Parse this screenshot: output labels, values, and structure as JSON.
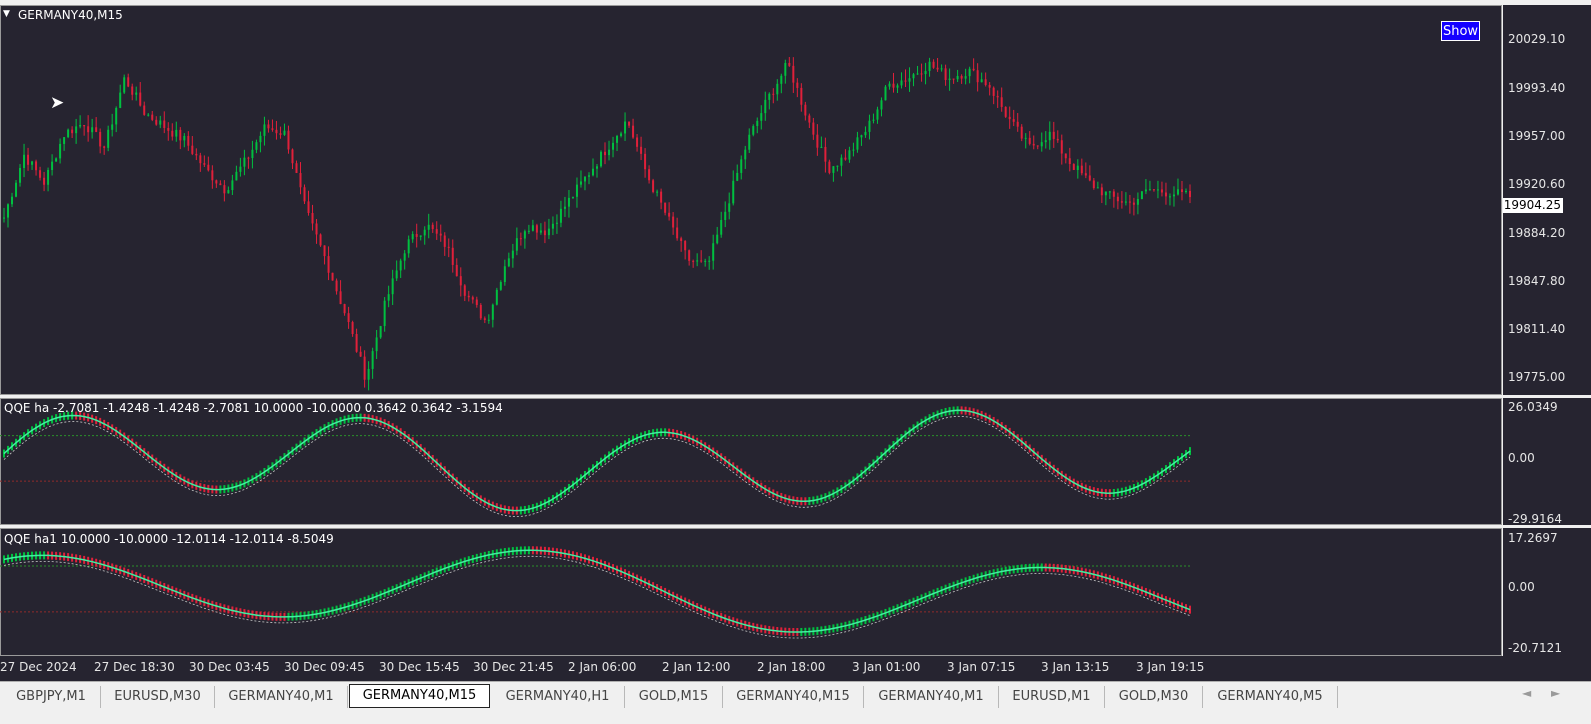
{
  "main_chart": {
    "title": "GERMANY40,M15",
    "show_button": "Show",
    "current_price": "19904.25",
    "y_ticks": [
      "20029.10",
      "19993.40",
      "19957.00",
      "19920.60",
      "19884.20",
      "19847.80",
      "19811.40",
      "19775.00"
    ],
    "colors": {
      "bull": "#00c040",
      "bear": "#e0203a",
      "background": "#262430"
    }
  },
  "indicator1": {
    "label": "QQE ha -2.7081 -1.4248 -1.4248 -2.7081 10.0000 -10.0000 0.3642 0.3642 -3.1594",
    "y_ticks": [
      "26.0349",
      "0.00",
      "-29.9164"
    ]
  },
  "indicator2": {
    "label": "QQE ha1 10.0000 -10.0000 -12.0114 -12.0114 -8.5049",
    "y_ticks": [
      "17.2697",
      "0.00",
      "-20.7121"
    ]
  },
  "x_axis": {
    "ticks": [
      "27 Dec 2024",
      "27 Dec 18:30",
      "30 Dec 03:45",
      "30 Dec 09:45",
      "30 Dec 15:45",
      "30 Dec 21:45",
      "2 Jan 06:00",
      "2 Jan 12:00",
      "2 Jan 18:00",
      "3 Jan 01:00",
      "3 Jan 07:15",
      "3 Jan 13:15",
      "3 Jan 19:15"
    ]
  },
  "tabs": [
    {
      "label": "GBPJPY,M1",
      "active": false
    },
    {
      "label": "EURUSD,M30",
      "active": false
    },
    {
      "label": "GERMANY40,M1",
      "active": false
    },
    {
      "label": "GERMANY40,M15",
      "active": true
    },
    {
      "label": "GERMANY40,H1",
      "active": false
    },
    {
      "label": "GOLD,M15",
      "active": false
    },
    {
      "label": "GERMANY40,M15",
      "active": false
    },
    {
      "label": "GERMANY40,M1",
      "active": false
    },
    {
      "label": "EURUSD,M1",
      "active": false
    },
    {
      "label": "GOLD,M30",
      "active": false
    },
    {
      "label": "GERMANY40,M5",
      "active": false
    }
  ],
  "nav": {
    "left": "◄",
    "right": "►"
  },
  "chart_data": {
    "type": "candlestick",
    "symbol": "GERMANY40,M15",
    "ylim": [
      19765,
      20040
    ],
    "x_labels": [
      "27 Dec 2024",
      "27 Dec 18:30",
      "30 Dec 03:45",
      "30 Dec 09:45",
      "30 Dec 15:45",
      "30 Dec 21:45",
      "2 Jan 06:00",
      "2 Jan 12:00",
      "2 Jan 18:00",
      "3 Jan 01:00",
      "3 Jan 07:15",
      "3 Jan 13:15",
      "3 Jan 19:15"
    ],
    "close_path": [
      19890,
      19935,
      19915,
      19950,
      19958,
      19940,
      19990,
      19965,
      19955,
      19945,
      19925,
      19910,
      19930,
      19955,
      19950,
      19895,
      19860,
      19820,
      19775,
      19830,
      19870,
      19885,
      19870,
      19835,
      19815,
      19860,
      19885,
      19880,
      19900,
      19920,
      19940,
      19960,
      19920,
      19890,
      19860,
      19855,
      19900,
      19945,
      19975,
      20000,
      19960,
      19925,
      19935,
      19955,
      19985,
      19990,
      20000,
      19990,
      19995,
      19985,
      19960,
      19940,
      19950,
      19930,
      19915,
      19905,
      19900,
      19910,
      19908,
      19905
    ],
    "indicator1_value": -2.7081,
    "indicator2_value": -8.5049
  }
}
